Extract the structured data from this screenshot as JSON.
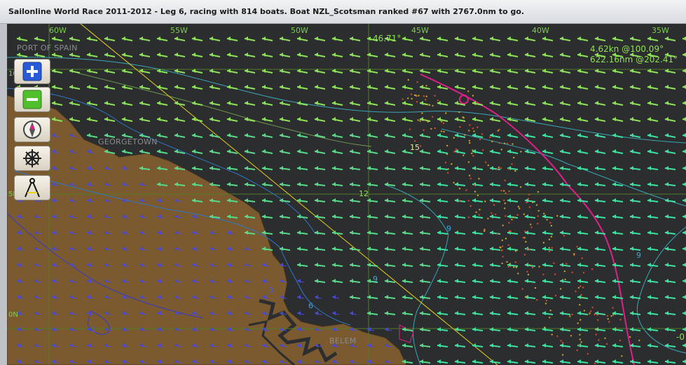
{
  "window": {
    "title": "Sailonline World Race 2011-2012 - Leg 6, racing with 814 boats. Boat NZL_Scotsman ranked #67 with 2767.0nm to go."
  },
  "map": {
    "longitudes": [
      "60W",
      "55W",
      "50W",
      "45W",
      "40W",
      "35W"
    ],
    "latitudes": [
      "10N",
      "5N",
      "0N"
    ],
    "places": [
      "PORT OF SPAIN",
      "GEORGETOWN",
      "BELEM"
    ],
    "cursor_heading": "46.71°",
    "wind_readout": "4.62kn @100.09°",
    "distance_readout": "622.16nm @202.41°",
    "edge_label": "-0",
    "contour_labels": [
      "15",
      "12",
      "9",
      "9",
      "9",
      "6",
      "3",
      "1"
    ],
    "colors": {
      "land": "#7a5a2e",
      "sea": "#2c2d2f",
      "grid": "#5d8f2f",
      "route": "#e0208a",
      "rhumb_line": "#e7d21a",
      "wind_arrow": "#4fdc72"
    }
  },
  "tools": {
    "zoom_in": "zoom-in",
    "zoom_out": "zoom-out",
    "center_boat": "center-on-boat",
    "steering": "steering-wheel",
    "measure": "measure-compass"
  }
}
